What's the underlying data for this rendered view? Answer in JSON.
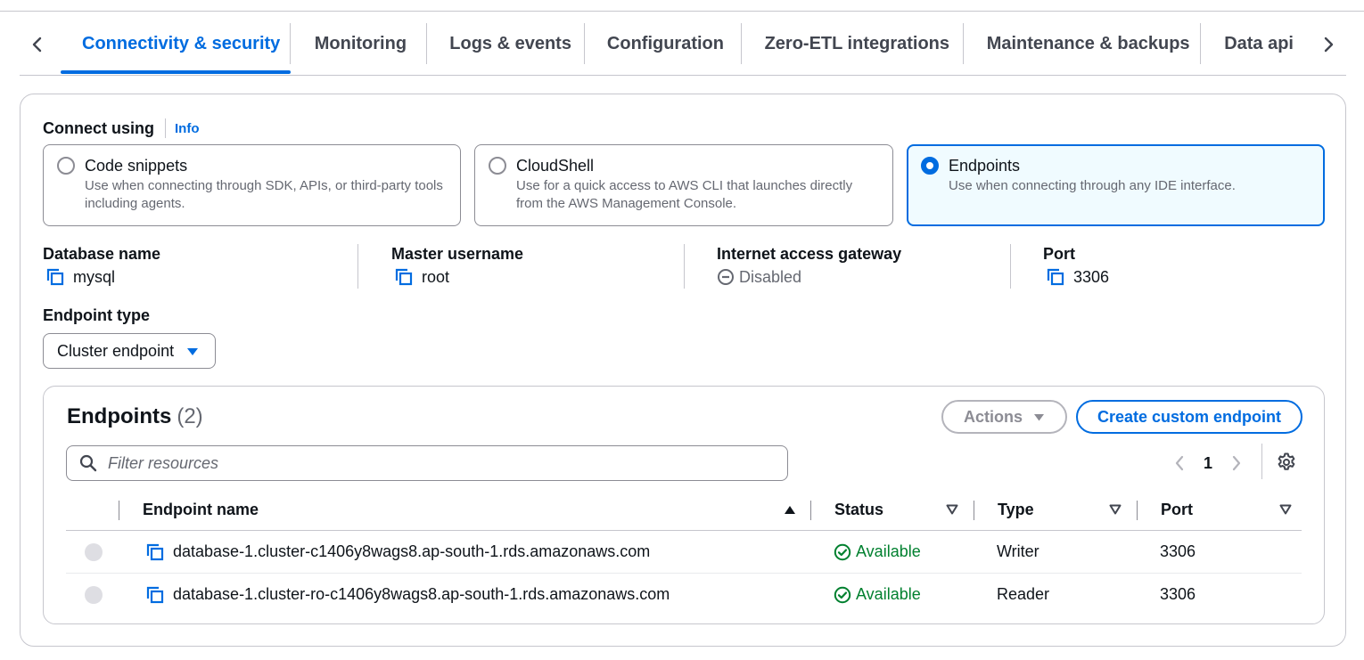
{
  "tabs": {
    "items": [
      {
        "label": "Connectivity & security",
        "active": true
      },
      {
        "label": "Monitoring"
      },
      {
        "label": "Logs & events"
      },
      {
        "label": "Configuration"
      },
      {
        "label": "Zero-ETL integrations"
      },
      {
        "label": "Maintenance & backups"
      },
      {
        "label": "Data api"
      }
    ],
    "left_arrow_icon": "chevron-left-icon",
    "right_arrow_icon": "chevron-right-icon"
  },
  "connect": {
    "label": "Connect using",
    "info": "Info",
    "options": [
      {
        "title": "Code snippets",
        "description": "Use when connecting through SDK, APIs, or third-party tools including agents.",
        "selected": false
      },
      {
        "title": "CloudShell",
        "description": "Use for a quick access to AWS CLI that launches directly from the AWS Management Console.",
        "selected": false
      },
      {
        "title": "Endpoints",
        "description": "Use when connecting through any IDE interface.",
        "selected": true
      }
    ]
  },
  "details": {
    "database_name": {
      "label": "Database name",
      "value": "mysql"
    },
    "master_username": {
      "label": "Master username",
      "value": "root"
    },
    "internet_access_gateway": {
      "label": "Internet access gateway",
      "value": "Disabled"
    },
    "port": {
      "label": "Port",
      "value": "3306"
    }
  },
  "endpoint_type": {
    "label": "Endpoint type",
    "value": "Cluster endpoint"
  },
  "endpoints": {
    "title": "Endpoints",
    "count": "(2)",
    "actions_label": "Actions",
    "create_label": "Create custom endpoint",
    "filter_placeholder": "Filter resources",
    "page": "1",
    "columns": [
      "Endpoint name",
      "Status",
      "Type",
      "Port"
    ],
    "rows": [
      {
        "name": "database-1.cluster-c1406y8wags8.ap-south-1.rds.amazonaws.com",
        "status": "Available",
        "type": "Writer",
        "port": "3306"
      },
      {
        "name": "database-1.cluster-ro-c1406y8wags8.ap-south-1.rds.amazonaws.com",
        "status": "Available",
        "type": "Reader",
        "port": "3306"
      }
    ]
  },
  "colors": {
    "accent": "#006ce0",
    "success": "#00802f",
    "border": "#c6c6cd",
    "muted": "#656871"
  }
}
